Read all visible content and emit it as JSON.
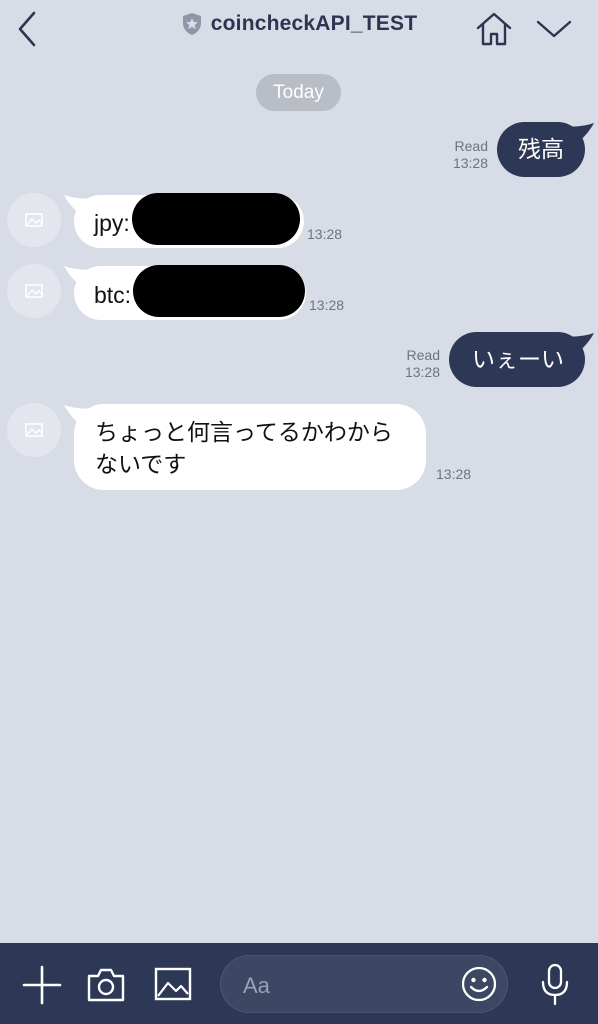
{
  "header": {
    "title": "coincheckAPI_TEST"
  },
  "date_divider": "Today",
  "messages": [
    {
      "side": "out",
      "text": "残高",
      "status": "Read",
      "time": "13:28"
    },
    {
      "side": "in",
      "prefix": "jpy:",
      "redacted": true,
      "time": "13:28"
    },
    {
      "side": "in",
      "prefix": "btc:",
      "redacted": true,
      "time": "13:28"
    },
    {
      "side": "out",
      "text": "いぇーい",
      "status": "Read",
      "time": "13:28"
    },
    {
      "side": "in",
      "text_line1": "ちょっと何言ってるかわから",
      "text_line2": "ないです",
      "time": "13:28"
    }
  ],
  "composer": {
    "placeholder": "Aa"
  },
  "colors": {
    "background": "#d8dce6",
    "outgoing_bubble": "#2c3855",
    "incoming_bubble": "#ffffff",
    "bar": "#2c3855"
  },
  "icons": [
    "back-chevron-icon",
    "shield-star-icon",
    "home-icon",
    "chevron-down-icon",
    "plus-icon",
    "camera-icon",
    "image-icon",
    "emoji-icon",
    "microphone-icon",
    "avatar-placeholder-icon"
  ]
}
